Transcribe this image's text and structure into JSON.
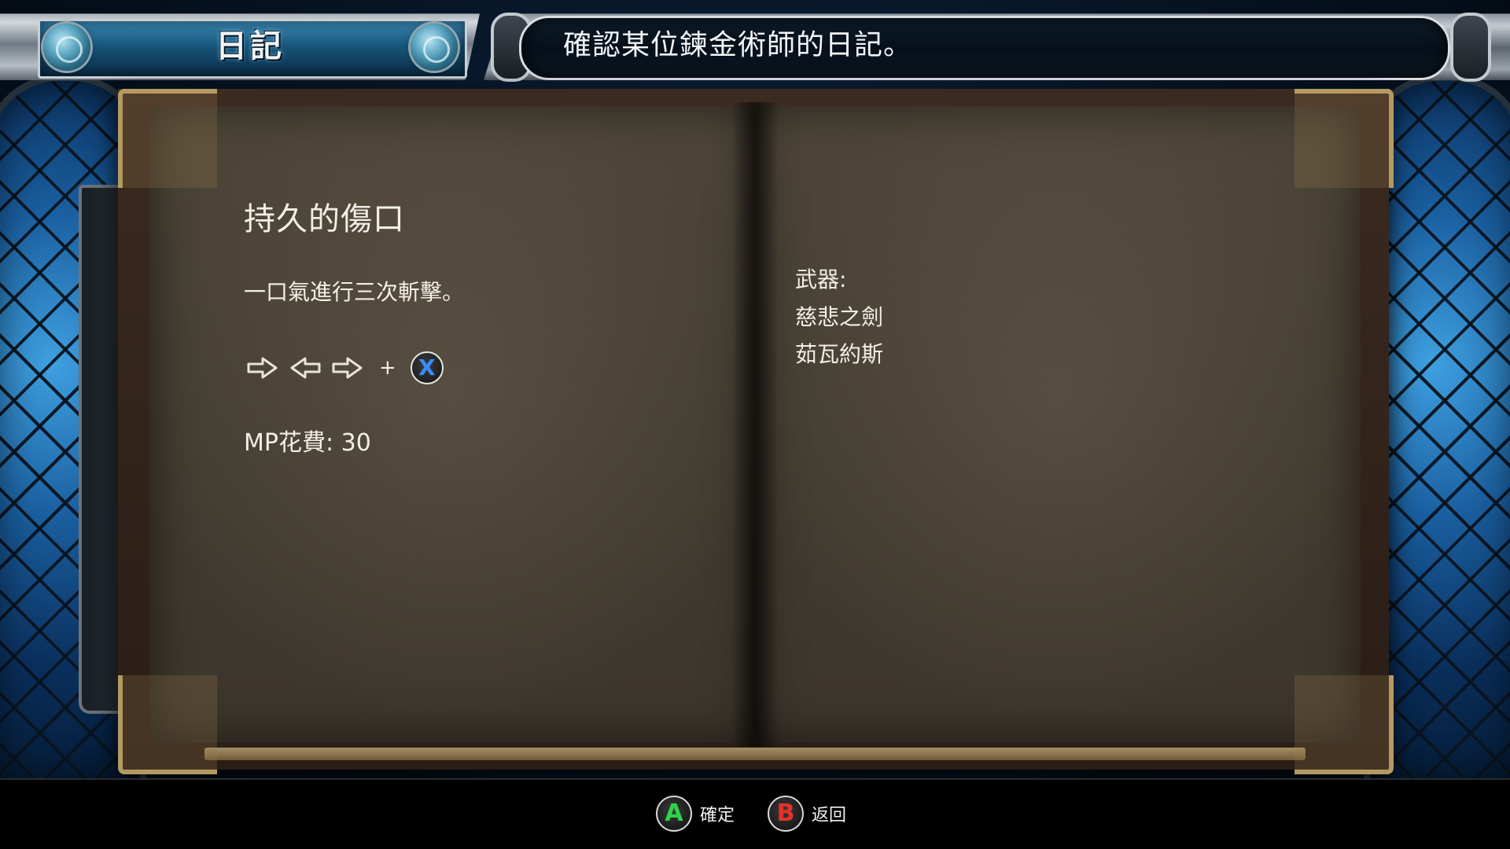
{
  "header": {
    "menu_title": "日記",
    "description": "確認某位鍊金術師的日記。"
  },
  "skill": {
    "name": "持久的傷口",
    "description": "一口氣進行三次斬擊。",
    "command": {
      "inputs": [
        "right-arrow-icon",
        "left-arrow-icon",
        "right-arrow-icon"
      ],
      "plus": "+",
      "button": "X",
      "button_color": "#3a8dff"
    },
    "mp_cost": "MP花費: 30"
  },
  "weapons": {
    "label": "武器:",
    "items": [
      "慈悲之劍",
      "茹瓦約斯"
    ]
  },
  "controls": {
    "confirm": {
      "button": "A",
      "label": "確定",
      "color": "#2dd34a"
    },
    "back": {
      "button": "B",
      "label": "返回",
      "color": "#e8302a"
    }
  }
}
